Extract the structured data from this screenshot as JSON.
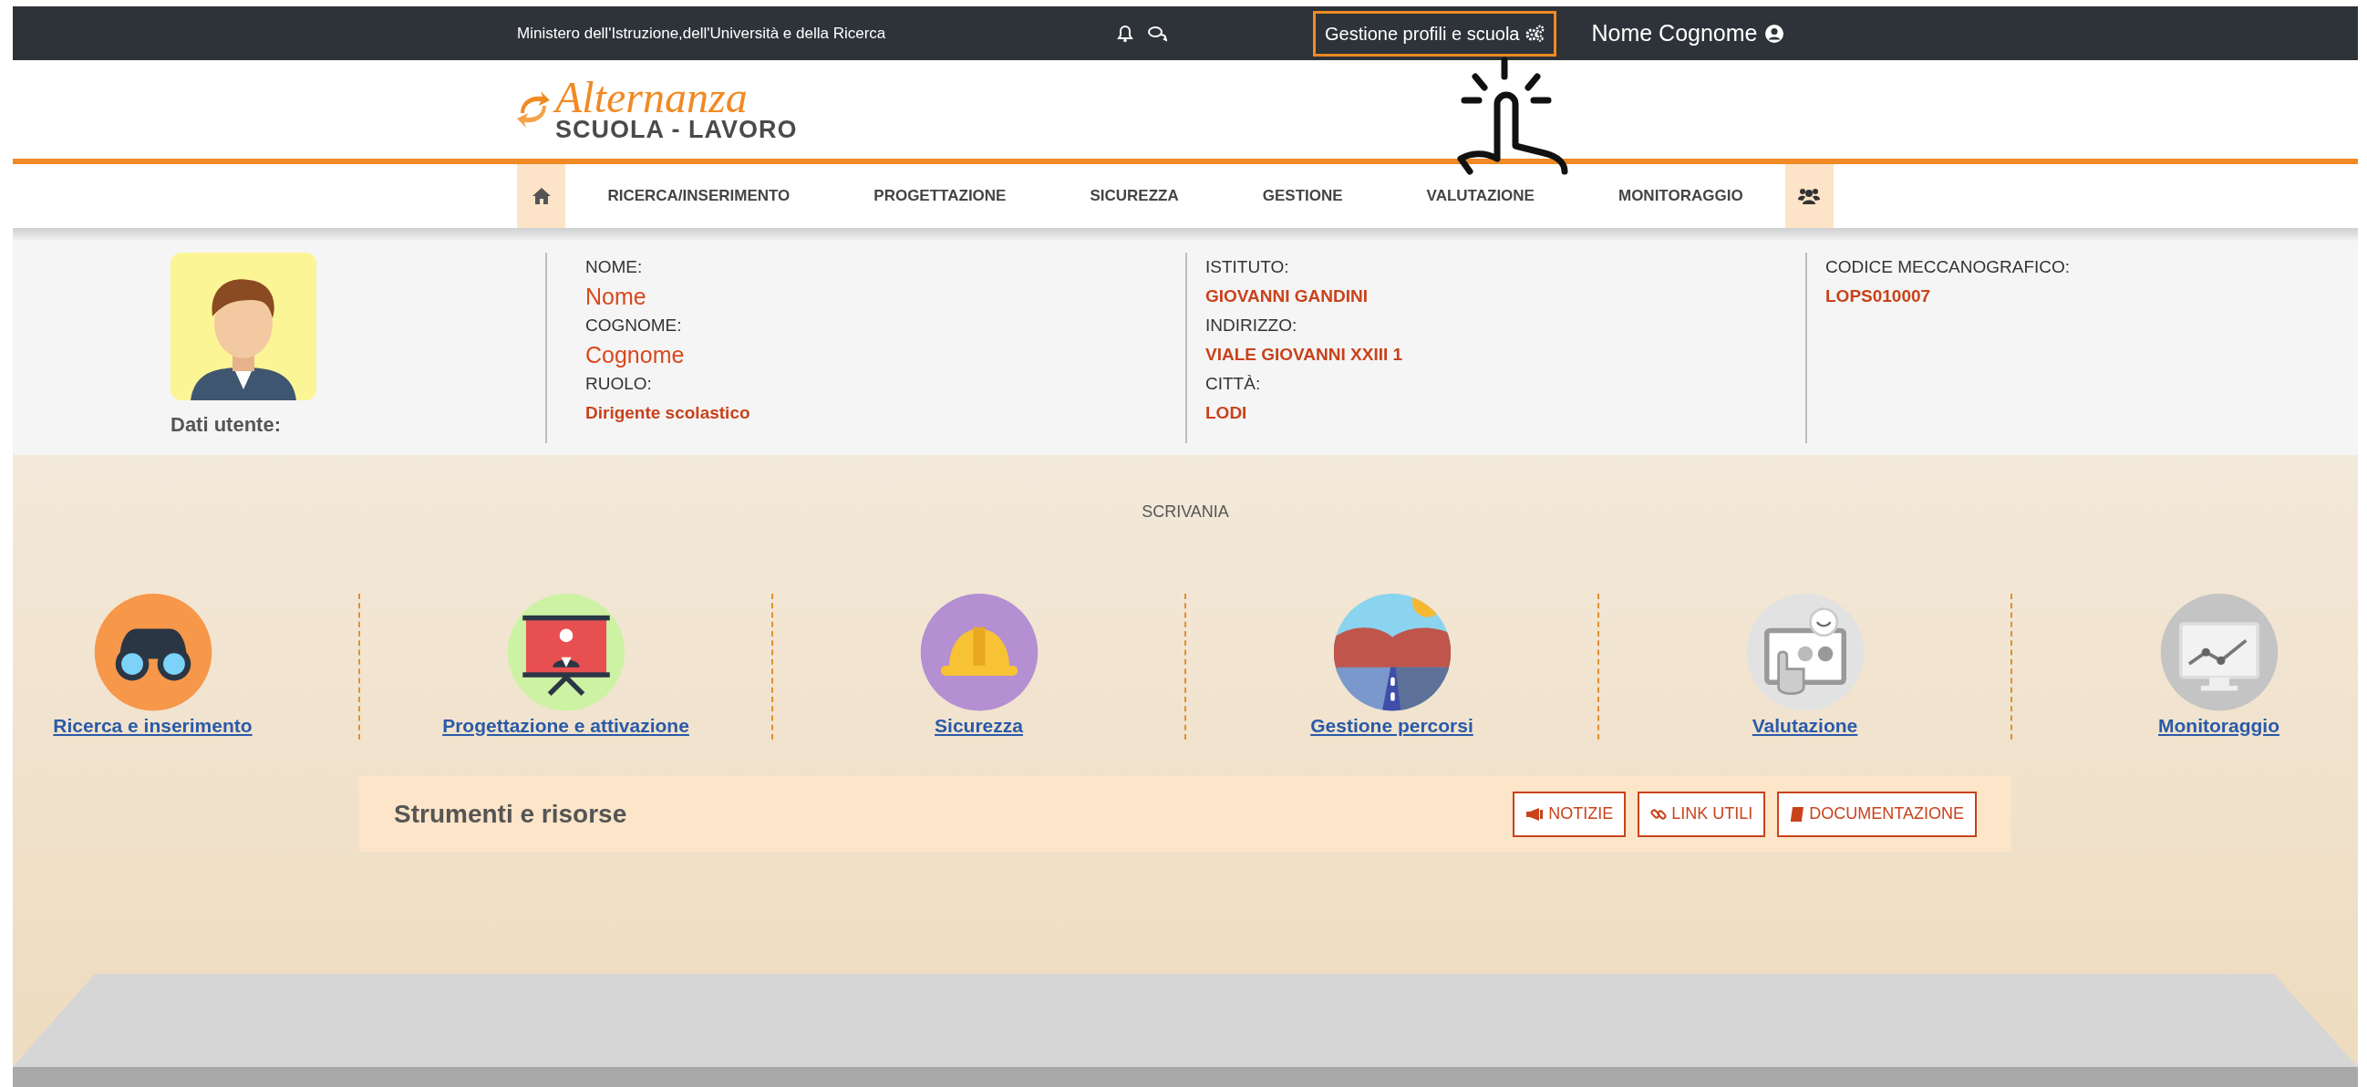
{
  "top_bar": {
    "ministry": "Ministero dell'Istruzione,dell'Università e della Ricerca",
    "profile_button": "Gestione profili e scuola",
    "user_name": "Nome Cognome"
  },
  "logo": {
    "title": "Alternanza",
    "subtitle": "SCUOLA - LAVORO"
  },
  "nav": [
    {
      "kind": "home"
    },
    {
      "kind": "text",
      "label": "RICERCA/INSERIMENTO"
    },
    {
      "kind": "text",
      "label": "PROGETTAZIONE"
    },
    {
      "kind": "text",
      "label": "SICUREZZA"
    },
    {
      "kind": "text",
      "label": "GESTIONE"
    },
    {
      "kind": "text",
      "label": "VALUTAZIONE"
    },
    {
      "kind": "text",
      "label": "MONITORAGGIO"
    },
    {
      "kind": "group"
    }
  ],
  "user_info": {
    "caption": "Dati utente:",
    "columns": [
      [
        {
          "label": "NOME:",
          "value": "Nome",
          "kind": "large"
        },
        {
          "label": "COGNOME:",
          "value": "Cognome",
          "kind": "large"
        },
        {
          "label": "RUOLO:",
          "value": "Dirigente scolastico",
          "kind": "bold"
        }
      ],
      [
        {
          "label": "ISTITUTO:",
          "value": "GIOVANNI GANDINI",
          "kind": "bold"
        },
        {
          "label": "INDIRIZZO:",
          "value": "VIALE GIOVANNI XXIII 1",
          "kind": "bold"
        },
        {
          "label": "CITTÀ:",
          "value": "LODI",
          "kind": "bold"
        }
      ],
      [
        {
          "label": "CODICE MECCANOGRAFICO:",
          "value": "LOPS010007",
          "kind": "bold"
        }
      ]
    ]
  },
  "desk": {
    "title": "SCRIVANIA",
    "sections": [
      {
        "kind": "binoculars",
        "label": "Ricerca e inserimento"
      },
      {
        "kind": "board",
        "label": "Progettazione e attivazione"
      },
      {
        "kind": "helmet",
        "label": "Sicurezza"
      },
      {
        "kind": "road",
        "label": "Gestione percorsi"
      },
      {
        "kind": "touch",
        "label": "Valutazione"
      },
      {
        "kind": "monitor",
        "label": "Monitoraggio"
      }
    ]
  },
  "tools": {
    "title": "Strumenti e risorse",
    "buttons": [
      {
        "kind": "megaphone",
        "label": "NOTIZIE"
      },
      {
        "kind": "link",
        "label": "LINK UTILI"
      },
      {
        "kind": "book",
        "label": "DOCUMENTAZIONE"
      }
    ]
  }
}
